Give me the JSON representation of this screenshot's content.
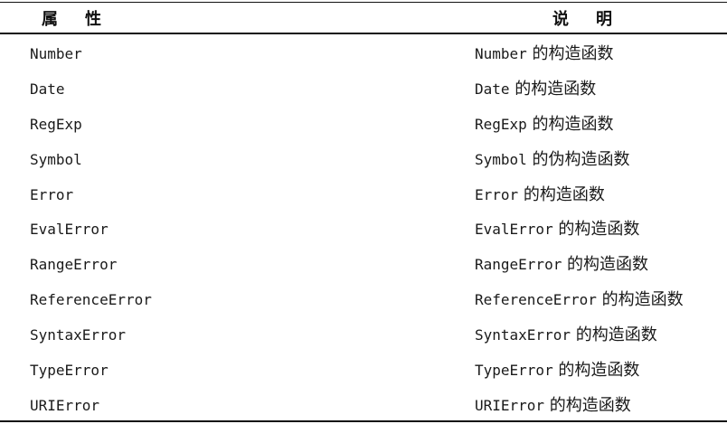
{
  "header": {
    "col_property": "属性",
    "col_description": "说明"
  },
  "rows": [
    {
      "property": "Number",
      "desc_code": "Number",
      "desc_text": " 的构造函数"
    },
    {
      "property": "Date",
      "desc_code": "Date",
      "desc_text": " 的构造函数"
    },
    {
      "property": "RegExp",
      "desc_code": "RegExp",
      "desc_text": " 的构造函数"
    },
    {
      "property": "Symbol",
      "desc_code": "Symbol",
      "desc_text": " 的伪构造函数"
    },
    {
      "property": "Error",
      "desc_code": "Error",
      "desc_text": " 的构造函数"
    },
    {
      "property": "EvalError",
      "desc_code": "EvalError",
      "desc_text": " 的构造函数"
    },
    {
      "property": "RangeError",
      "desc_code": "RangeError",
      "desc_text": " 的构造函数"
    },
    {
      "property": "ReferenceError",
      "desc_code": "ReferenceError",
      "desc_text": " 的构造函数"
    },
    {
      "property": "SyntaxError",
      "desc_code": "SyntaxError",
      "desc_text": " 的构造函数"
    },
    {
      "property": "TypeError",
      "desc_code": "TypeError",
      "desc_text": " 的构造函数"
    },
    {
      "property": "URIError",
      "desc_code": "URIError",
      "desc_text": " 的构造函数"
    }
  ]
}
